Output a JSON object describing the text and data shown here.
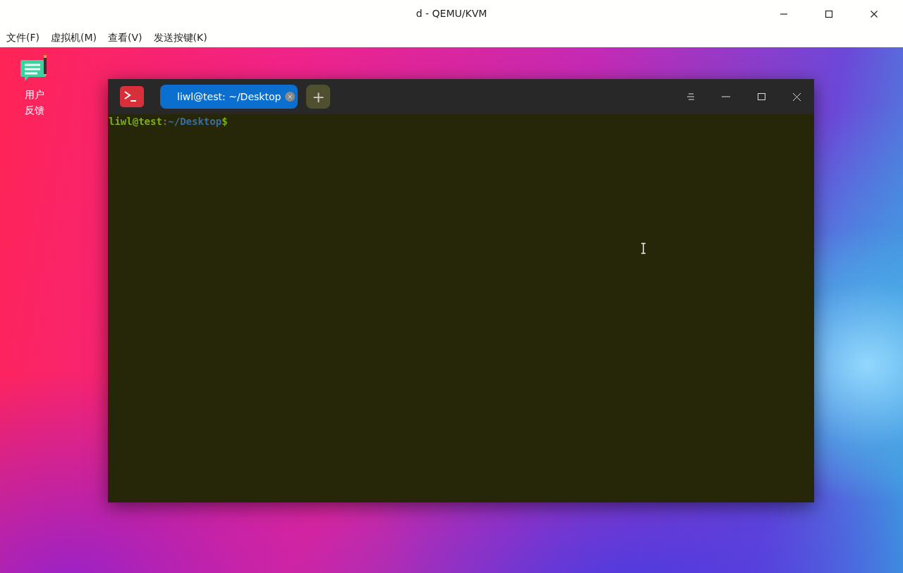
{
  "window": {
    "title": "d - QEMU/KVM"
  },
  "menu": [
    {
      "label": "文件(F)"
    },
    {
      "label": "虚拟机(M)"
    },
    {
      "label": "查看(V)"
    },
    {
      "label": "发送按键(K)"
    }
  ],
  "desktop_icons": [
    {
      "label": "用户反馈"
    }
  ],
  "terminal": {
    "tabs": [
      {
        "label": "liwl@test: ~/Desktop",
        "selected": true
      }
    ],
    "new_tab": "+",
    "prompt": {
      "user_host": "liwl@test",
      "separator": ":",
      "path": "~/Desktop",
      "symbol": "$"
    }
  }
}
